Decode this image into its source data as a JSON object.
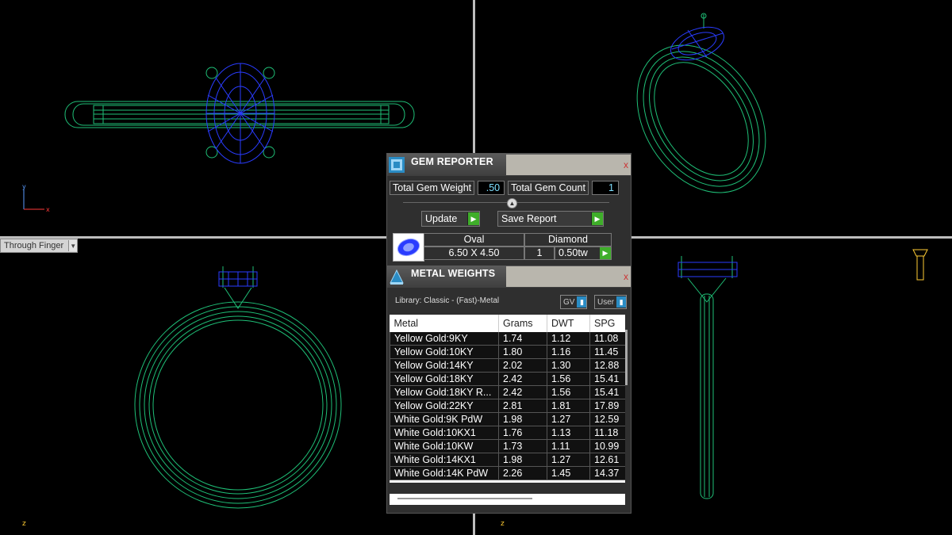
{
  "viewport": {
    "label": "Through Finger",
    "axis_top_left": {
      "up": "y",
      "right": "x"
    },
    "axis_bottom_left": "z",
    "axis_bottom_right": "z"
  },
  "colors": {
    "wire_green": "#1fbf77",
    "gem_blue": "#2a3cff",
    "axis_red": "#ff3a3a",
    "axis_blue": "#5a9cff",
    "go_green": "#3fae2a"
  },
  "gem_reporter": {
    "icon": "gem-reporter-icon",
    "title": "GEM REPORTER",
    "close": "x",
    "total_gem_weight_label": "Total Gem Weight",
    "total_gem_weight_value": ".50",
    "total_gem_count_label": "Total Gem Count",
    "total_gem_count_value": "1",
    "update_label": "Update",
    "save_report_label": "Save Report",
    "gem": {
      "shape": "Oval",
      "type": "Diamond",
      "size": "6.50 X 4.50",
      "count": "1",
      "weight": "0.50tw"
    }
  },
  "metal_weights": {
    "icon": "metal-weights-icon",
    "title": "METAL WEIGHTS",
    "close": "x",
    "library": "Library: Classic - (Fast)-Metal",
    "toggle_gv": "GV",
    "toggle_user": "User",
    "columns": [
      "Metal",
      "Grams",
      "DWT",
      "SPG"
    ],
    "rows": [
      [
        "Yellow Gold:9KY",
        "1.74",
        "1.12",
        "11.08"
      ],
      [
        "Yellow Gold:10KY",
        "1.80",
        "1.16",
        "11.45"
      ],
      [
        "Yellow Gold:14KY",
        "2.02",
        "1.30",
        "12.88"
      ],
      [
        "Yellow Gold:18KY",
        "2.42",
        "1.56",
        "15.41"
      ],
      [
        "Yellow Gold:18KY R...",
        "2.42",
        "1.56",
        "15.41"
      ],
      [
        "Yellow Gold:22KY",
        "2.81",
        "1.81",
        "17.89"
      ],
      [
        "White Gold:9K PdW",
        "1.98",
        "1.27",
        "12.59"
      ],
      [
        "White Gold:10KX1",
        "1.76",
        "1.13",
        "11.18"
      ],
      [
        "White Gold:10KW",
        "1.73",
        "1.11",
        "10.99"
      ],
      [
        "White Gold:14KX1",
        "1.98",
        "1.27",
        "12.61"
      ],
      [
        "White Gold:14K PdW",
        "2.26",
        "1.45",
        "14.37"
      ]
    ]
  }
}
